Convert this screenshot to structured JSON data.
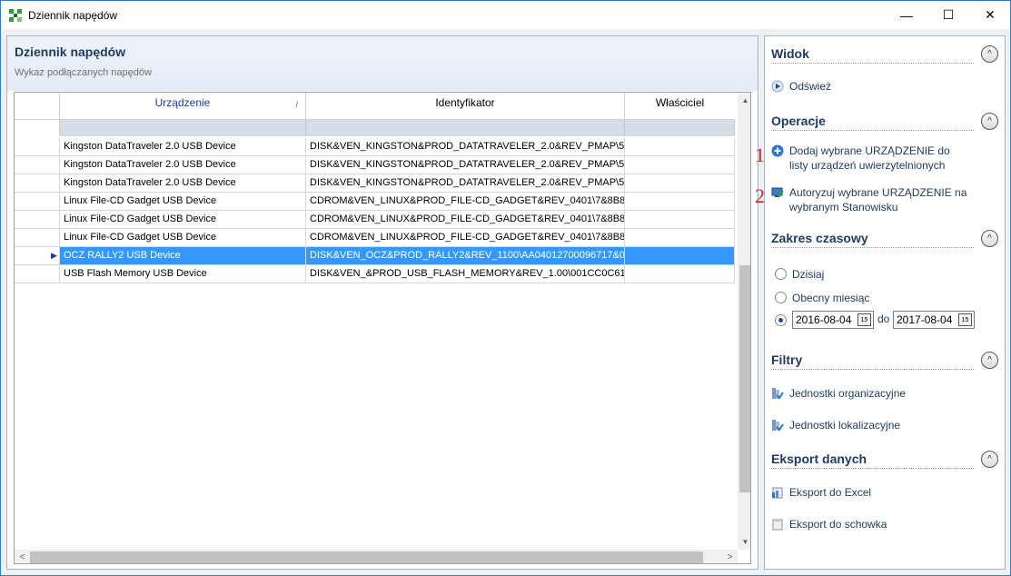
{
  "window": {
    "title": "Dziennik napędów",
    "minimize_glyph": "—",
    "maximize_glyph": "☐",
    "close_glyph": "✕"
  },
  "main": {
    "title": "Dziennik napędów",
    "subtitle": "Wykaz podłączanych napędów",
    "columns": [
      {
        "label": "Urządzenie",
        "color": "#1a3ea8"
      },
      {
        "label": "Identyfikator",
        "color": "#000000"
      },
      {
        "label": "Właściciel",
        "color": "#000000"
      }
    ],
    "sort_glyph": "/",
    "rows": [
      {
        "device": "Kingston DataTraveler 2.0 USB Device",
        "id": "DISK&VEN_KINGSTON&PROD_DATATRAVELER_2.0&REV_PMAP\\5",
        "owner": "",
        "selected": false
      },
      {
        "device": "Kingston DataTraveler 2.0 USB Device",
        "id": "DISK&VEN_KINGSTON&PROD_DATATRAVELER_2.0&REV_PMAP\\5",
        "owner": "",
        "selected": false
      },
      {
        "device": "Kingston DataTraveler 2.0 USB Device",
        "id": "DISK&VEN_KINGSTON&PROD_DATATRAVELER_2.0&REV_PMAP\\5",
        "owner": "",
        "selected": false
      },
      {
        "device": "Linux File-CD Gadget USB Device",
        "id": "CDROM&VEN_LINUX&PROD_FILE-CD_GADGET&REV_0401\\7&8B8",
        "owner": "",
        "selected": false
      },
      {
        "device": "Linux File-CD Gadget USB Device",
        "id": "CDROM&VEN_LINUX&PROD_FILE-CD_GADGET&REV_0401\\7&8B8",
        "owner": "",
        "selected": false
      },
      {
        "device": "Linux File-CD Gadget USB Device",
        "id": "CDROM&VEN_LINUX&PROD_FILE-CD_GADGET&REV_0401\\7&8B8",
        "owner": "",
        "selected": false
      },
      {
        "device": "OCZ RALLY2 USB Device",
        "id": "DISK&VEN_OCZ&PROD_RALLY2&REV_1100\\AA04012700096717&0",
        "owner": "",
        "selected": true
      },
      {
        "device": "USB Flash Memory USB Device",
        "id": "DISK&VEN_&PROD_USB_FLASH_MEMORY&REV_1.00\\001CC0C612",
        "owner": "",
        "selected": false
      }
    ],
    "row_indicator_glyph": "▶",
    "scroll": {
      "up": "▲",
      "down": "▼",
      "left": "<",
      "right": ">"
    }
  },
  "side": {
    "collapse_glyph": "^",
    "widok": {
      "title": "Widok",
      "refresh": "Odśwież"
    },
    "operacje": {
      "title": "Operacje",
      "add_marker": "1",
      "add": "Dodaj wybrane URZĄDZENIE do listy urządzeń uwierzytelnionych",
      "auth_marker": "2",
      "authorize": "Autoryzuj wybrane URZĄDZENIE na wybranym Stanowisku"
    },
    "zakres": {
      "title": "Zakres czasowy",
      "today": "Dzisiaj",
      "month": "Obecny miesiąc",
      "date_from": "2016-08-04",
      "date_to": "2017-08-04",
      "date_btn": "15",
      "do": "do",
      "selected_option": "range"
    },
    "filtry": {
      "title": "Filtry",
      "org": "Jednostki organizacyjne",
      "loc": "Jednostki lokalizacyjne"
    },
    "eksport": {
      "title": "Eksport danych",
      "excel": "Eksport do Excel",
      "clipboard": "Eksport do schowka"
    }
  }
}
